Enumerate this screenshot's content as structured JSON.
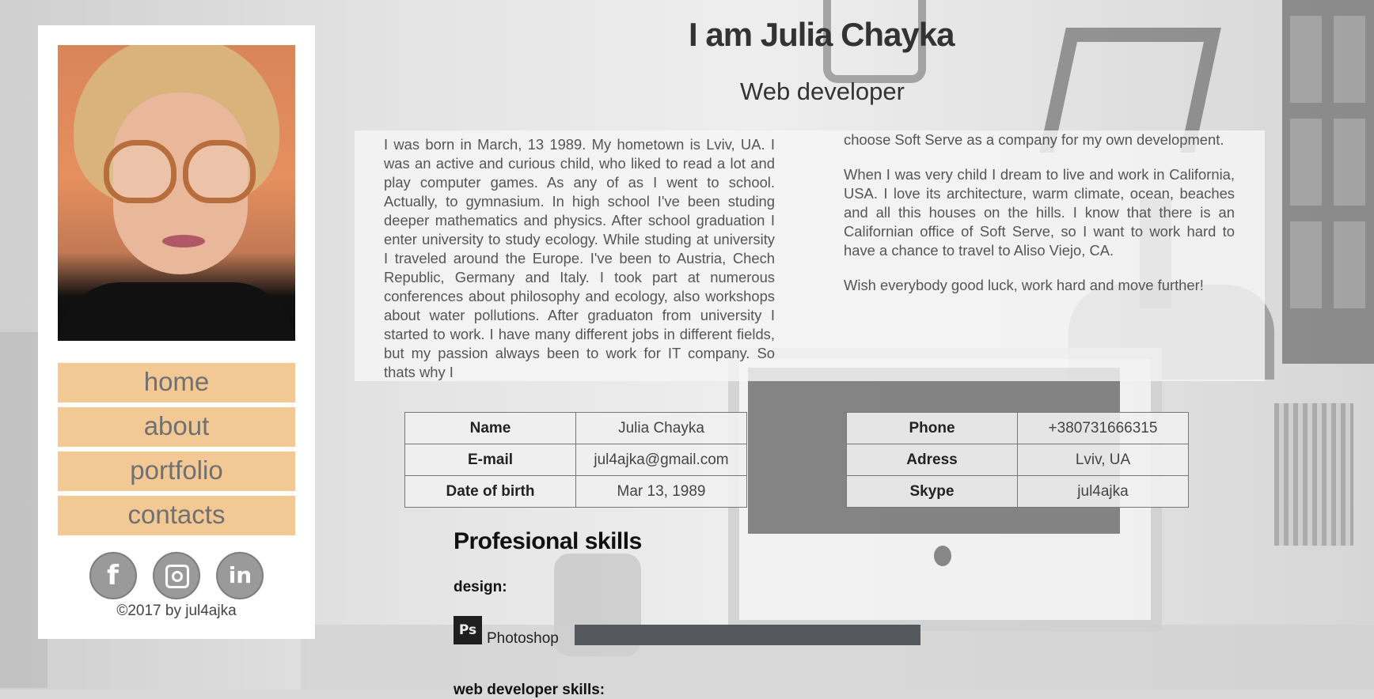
{
  "header": {
    "title": "I am Julia Chayka",
    "subtitle": "Web developer"
  },
  "sidebar": {
    "photo_alt": "Julia Chayka portrait",
    "nav": [
      {
        "label": "home"
      },
      {
        "label": "about"
      },
      {
        "label": "portfolio"
      },
      {
        "label": "contacts"
      }
    ],
    "social": [
      "facebook-icon",
      "instagram-icon",
      "linkedin-icon"
    ],
    "copyright": "©2017 by jul4ajka"
  },
  "about": {
    "col1": "I was born in March, 13 1989. My hometown is Lviv, UA. I was an active and curious child, who liked to read a lot and play computer games. As any of as I went to school. Actually, to gymnasium. In high school I've been studing deeper mathematics and physics. After school graduation I enter university to study ecology. While studing at university I traveled around the Europe. I've been to Austria, Chech Republic, Germany and Italy. I took part at numerous conferences about philosophy and ecology, also workshops about water pollutions. After graduaton from university I started to work. I have many different jobs in different fields, but my passion always been to work for IT company. So thats why I",
    "col2_p1": "choose Soft Serve as a company for my own development.",
    "col2_p2": "When I was very child I dream to live and work in California, USA. I love its architecture, warm climate, ocean, beaches and all this houses on the hills. I know that there is an Californian office of Soft Serve, so I want to work hard to have a chance to travel to Aliso Viejo, CA.",
    "col2_p3": "Wish everybody good luck, work hard and move further!"
  },
  "info_left": [
    {
      "key": "Name",
      "value": "Julia Chayka"
    },
    {
      "key": "E-mail",
      "value": "jul4ajka@gmail.com"
    },
    {
      "key": "Date of birth",
      "value": "Mar 13, 1989"
    }
  ],
  "info_right": [
    {
      "key": "Phone",
      "value": "+380731666315"
    },
    {
      "key": "Adress",
      "value": "Lviv, UA"
    },
    {
      "key": "Skype",
      "value": "jul4ajka"
    }
  ],
  "skills": {
    "title": "Profesional skills",
    "design_label": "design:",
    "photoshop_icon": "Ps",
    "photoshop_name": "Photoshop",
    "photoshop_level": 1.0,
    "web_label": "web developer skills:"
  },
  "colors": {
    "nav_bg": "#f2c994",
    "nav_text": "#707070",
    "skill_bar": "#55585c"
  }
}
